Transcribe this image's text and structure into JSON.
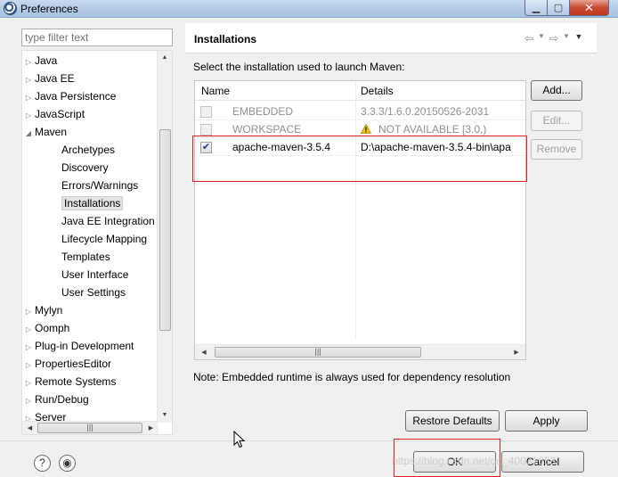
{
  "window": {
    "title": "Preferences"
  },
  "filter": {
    "placeholder": "type filter text"
  },
  "tree": {
    "items": [
      {
        "label": "Java",
        "arrow": "▷"
      },
      {
        "label": "Java EE",
        "arrow": "▷"
      },
      {
        "label": "Java Persistence",
        "arrow": "▷"
      },
      {
        "label": "JavaScript",
        "arrow": "▷"
      },
      {
        "label": "Maven",
        "arrow": "◢"
      },
      {
        "label": "Mylyn",
        "arrow": "▷"
      },
      {
        "label": "Oomph",
        "arrow": "▷"
      },
      {
        "label": "Plug-in Development",
        "arrow": "▷"
      },
      {
        "label": "PropertiesEditor",
        "arrow": "▷"
      },
      {
        "label": "Remote Systems",
        "arrow": "▷"
      },
      {
        "label": "Run/Debug",
        "arrow": "▷"
      },
      {
        "label": "Server",
        "arrow": "▷"
      }
    ],
    "maven_children": [
      "Archetypes",
      "Discovery",
      "Errors/Warnings",
      "Installations",
      "Java EE Integration",
      "Lifecycle Mapping",
      "Templates",
      "User Interface",
      "User Settings"
    ],
    "selected": "Installations"
  },
  "page": {
    "title": "Installations",
    "description": "Select the installation used to launch Maven:",
    "table": {
      "columns": [
        "Name",
        "Details"
      ],
      "rows": [
        {
          "checked": false,
          "enabled": false,
          "name": "EMBEDDED",
          "details": "3.3.3/1.6.0.20150526-2031"
        },
        {
          "checked": false,
          "enabled": false,
          "name": "WORKSPACE",
          "details": "NOT AVAILABLE [3.0,)",
          "warning": true
        },
        {
          "checked": true,
          "enabled": true,
          "name": "apache-maven-3.5.4",
          "details": "D:\\apache-maven-3.5.4-bin\\apa"
        }
      ]
    },
    "buttons": {
      "add": "Add...",
      "edit": "Edit...",
      "remove": "Remove"
    },
    "note": "Note: Embedded runtime is always used for dependency resolution"
  },
  "actions": {
    "restore_defaults": "Restore Defaults",
    "apply": "Apply",
    "ok": "OK",
    "cancel": "Cancel"
  },
  "watermark": "https://blog.csdn.net/qq_40031653",
  "colors": {
    "highlight": "#e02020",
    "warning": "#e8b500"
  }
}
